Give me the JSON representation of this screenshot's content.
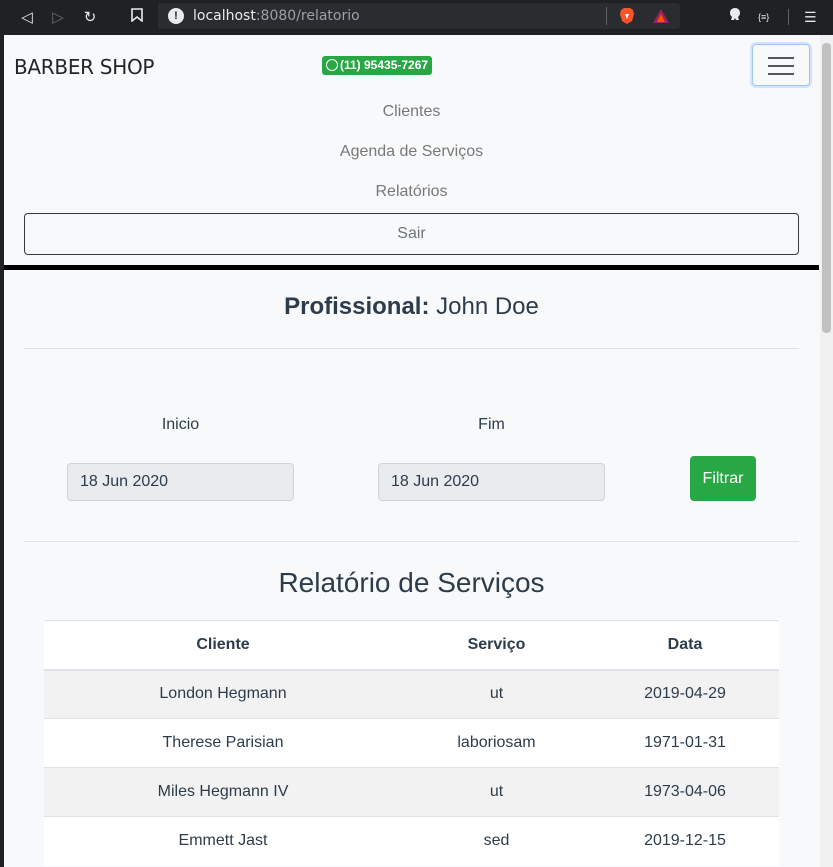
{
  "browser": {
    "url_host": "localhost",
    "url_rest": ":8080/relatorio"
  },
  "navbar": {
    "brand": "BARBER SHOP",
    "phone": "(11) 95435-7267",
    "links": [
      "Clientes",
      "Agenda de Serviços",
      "Relatórios"
    ],
    "logout": "Sair"
  },
  "profile": {
    "label": "Profissional:",
    "name": "John Doe"
  },
  "filter": {
    "start_label": "Inicio",
    "start_value": "18 Jun 2020",
    "end_label": "Fim",
    "end_value": "18 Jun 2020",
    "button": "Filtrar"
  },
  "report": {
    "title": "Relatório de Serviços",
    "columns": [
      "Cliente",
      "Serviço",
      "Data"
    ],
    "rows": [
      [
        "London Hegmann",
        "ut",
        "2019-04-29"
      ],
      [
        "Therese Parisian",
        "laboriosam",
        "1971-01-31"
      ],
      [
        "Miles Hegmann IV",
        "ut",
        "1973-04-06"
      ],
      [
        "Emmett Jast",
        "sed",
        "2019-12-15"
      ]
    ]
  },
  "colors": {
    "accent_green": "#28a745",
    "text": "#2d3c4b"
  }
}
